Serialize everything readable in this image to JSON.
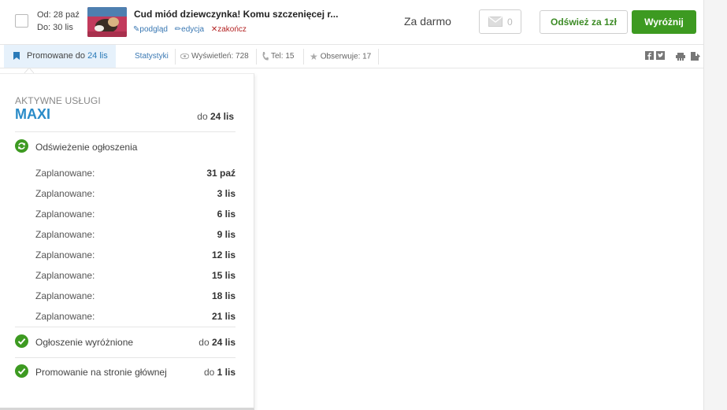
{
  "listing": {
    "from_label": "Od: 28 paź",
    "to_label": "Do: 30 lis",
    "title": "Cud miód dziewczynka! Komu szczenięcej r...",
    "preview_link": "podgląd",
    "edit_link": "edycja",
    "end_link": "zakończ",
    "price": "Za darmo",
    "messages_count": "0",
    "refresh_button": "Odśwież za 1zł",
    "highlight_button": "Wyróżnij"
  },
  "infobar": {
    "promo_label": "Promowane do",
    "promo_date": "24 lis",
    "stats_link": "Statystyki",
    "views": "Wyświetleń: 728",
    "phone": "Tel: 15",
    "watchers": "Obserwuje: 17",
    "icons": [
      "bookmark-icon",
      "eye-icon",
      "phone-icon",
      "star-icon",
      "facebook-icon",
      "twitter-icon",
      "print-icon",
      "export-icon"
    ]
  },
  "panel": {
    "heading": "AKTYWNE USŁUGI",
    "package_name": "MAXI",
    "package_until_prefix": "do",
    "package_until_date": "24 lis",
    "refresh_service": "Odświeżenie ogłoszenia",
    "schedule": [
      {
        "label": "Zaplanowane:",
        "date": "31 paź"
      },
      {
        "label": "Zaplanowane:",
        "date": "3 lis"
      },
      {
        "label": "Zaplanowane:",
        "date": "6 lis"
      },
      {
        "label": "Zaplanowane:",
        "date": "9 lis"
      },
      {
        "label": "Zaplanowane:",
        "date": "12 lis"
      },
      {
        "label": "Zaplanowane:",
        "date": "15 lis"
      },
      {
        "label": "Zaplanowane:",
        "date": "18 lis"
      },
      {
        "label": "Zaplanowane:",
        "date": "21 lis"
      }
    ],
    "highlight_service": "Ogłoszenie wyróżnione",
    "highlight_prefix": "do",
    "highlight_date": "24 lis",
    "homepage_service": "Promowanie na stronie głównej",
    "homepage_prefix": "do",
    "homepage_date": "1 lis"
  },
  "colors": {
    "accent_blue": "#2a8bc8",
    "accent_green": "#3d9a21",
    "promo_bg": "#e6f1fb"
  }
}
